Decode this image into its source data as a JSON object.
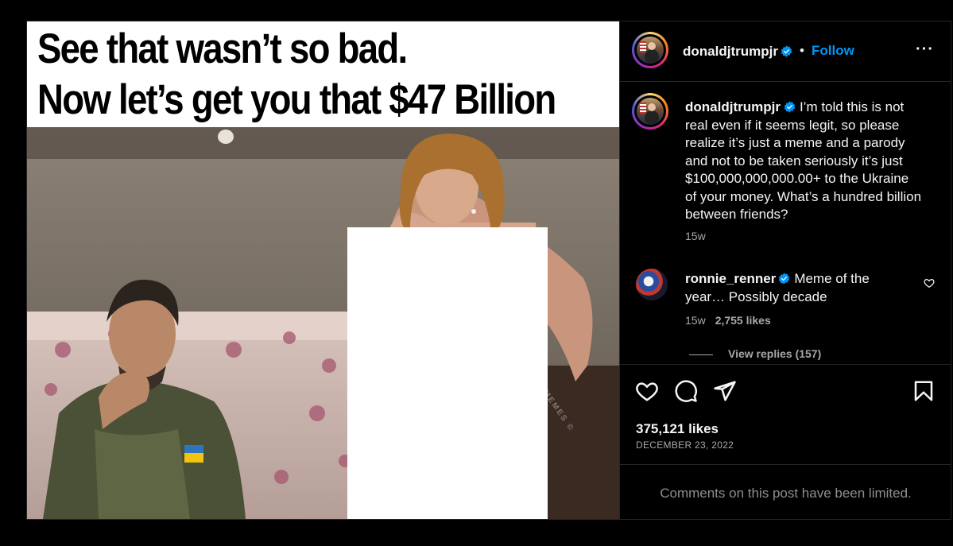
{
  "meme": {
    "line1": "See that wasn’t so bad.",
    "line2": "Now let’s get you that $47 Billion",
    "watermark": "OLDMEMES ©"
  },
  "header": {
    "username": "donaldjtrumpjr",
    "separator": "•",
    "follow_label": "Follow",
    "more_label": "···"
  },
  "caption": {
    "username": "donaldjtrumpjr",
    "text": "I’m told this is not real even if it seems legit, so please realize it’s just a meme and a parody and not to be taken seriously it’s just $100,000,000,000.00+ to the Ukraine of your money. What’s a hundred billion between friends?",
    "time": "15w"
  },
  "comment": {
    "username": "ronnie_renner",
    "text": "Meme of the year… Possibly decade",
    "time": "15w",
    "likes": "2,755 likes",
    "view_replies": "View replies (157)"
  },
  "post": {
    "likes": "375,121 likes",
    "date": "DECEMBER 23, 2022",
    "comments_limited": "Comments on this post have been limited."
  },
  "icons": {
    "like": "heart-icon",
    "comment": "speech-bubble-icon",
    "share": "paper-plane-icon",
    "save": "bookmark-icon",
    "verified": "verified-badge-icon"
  },
  "colors": {
    "background": "#000000",
    "accent": "#0095f6",
    "verified": "#0095f6",
    "muted_text": "#a8a8a8"
  }
}
